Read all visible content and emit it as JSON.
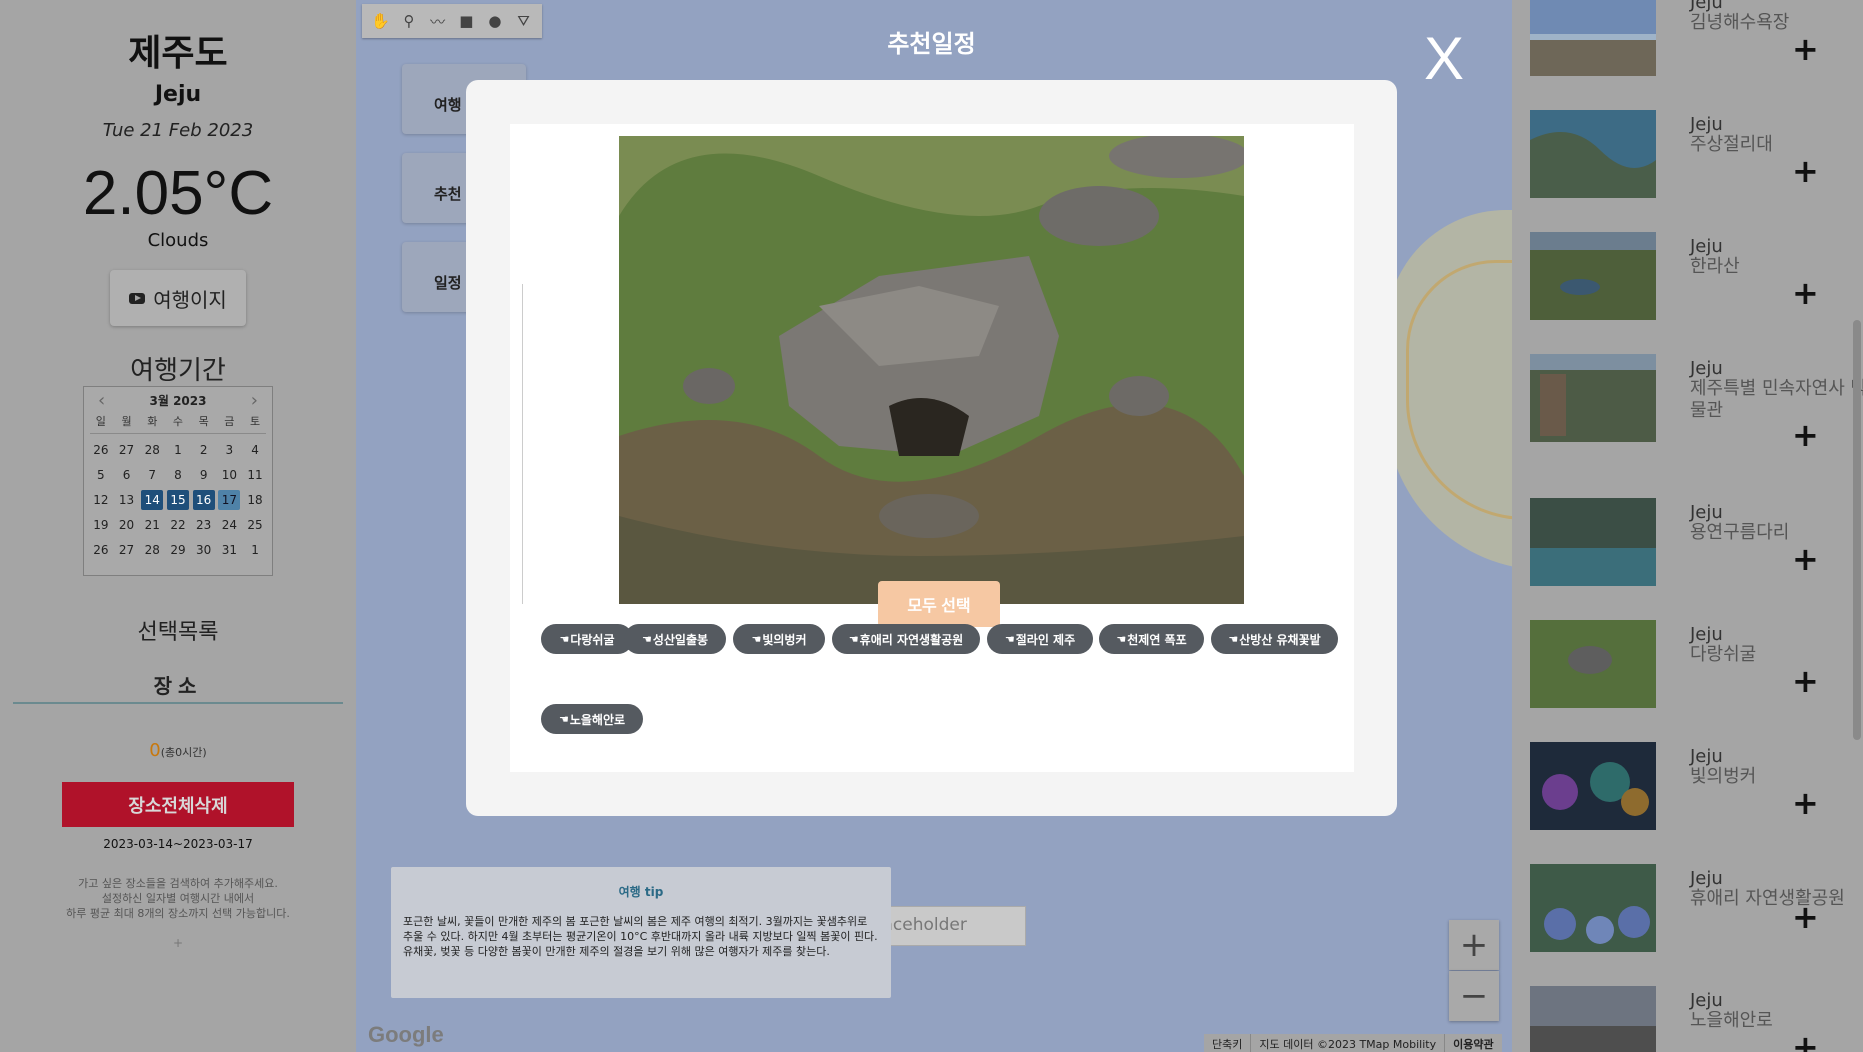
{
  "left": {
    "city_ko": "제주도",
    "city_en": "Jeju",
    "date": "Tue 21 Feb 2023",
    "temperature": "2.05°C",
    "weather": "Clouds",
    "brand_label": "여행이지",
    "period_title": "여행기간",
    "calendar": {
      "month_title": "3월 2023",
      "prev_arrow": "‹",
      "next_arrow": "›",
      "weekdays": [
        "일",
        "월",
        "화",
        "수",
        "목",
        "금",
        "토"
      ],
      "weeks": [
        [
          "26",
          "27",
          "28",
          "1",
          "2",
          "3",
          "4"
        ],
        [
          "5",
          "6",
          "7",
          "8",
          "9",
          "10",
          "11"
        ],
        [
          "12",
          "13",
          "14",
          "15",
          "16",
          "17",
          "18"
        ],
        [
          "19",
          "20",
          "21",
          "22",
          "23",
          "24",
          "25"
        ],
        [
          "26",
          "27",
          "28",
          "29",
          "30",
          "31",
          "1"
        ]
      ]
    },
    "list_title": "선택목록",
    "tab_place": "장소",
    "count_value": "0",
    "count_unit": "(총0시간)",
    "delete_all": "장소전체삭제",
    "range": "2023-03-14~2023-03-17",
    "help_lines": [
      "가고 싶은 장소들을 검색하여 추가해주세요.",
      "설정하신 일자별 여행시간 내에서",
      "하루 평균 최대 8개의 장소까지 선택 가능합니다."
    ],
    "help_plus": "+"
  },
  "map": {
    "tabs": [
      "여행",
      "추천",
      "일정"
    ],
    "search_placeholder": "placeholder",
    "zoom_in": "+",
    "zoom_out": "−",
    "google": "Google",
    "footer": [
      "단축키",
      "지도 데이터 ©2023 TMap Mobility",
      "이용약관"
    ],
    "tip_title": "여행 tip",
    "tip_body": "포근한 날씨, 꽃들이 만개한 제주의 봄 포근한 날씨의 봄은 제주 여행의 최적기. 3월까지는 꽃샘추위로 추울 수 있다. 하지만 4월 초부터는 평균기온이 10°C 후반대까지 올라 내륙 지방보다 일찍 봄꽃이 핀다. 유채꽃, 벚꽃 등 다양한 봄꽃이 만개한 제주의 절경을 보기 위해 많은 여행자가 제주를 찾는다."
  },
  "modal": {
    "title": "추천일정",
    "close": "X",
    "select_all": "모두 선택",
    "chips": [
      "다랑쉬굴",
      "성산일출봉",
      "빛의벙커",
      "휴애리 자연생활공원",
      "절라인 제주",
      "천제연 폭포",
      "산방산 유채꽃밭",
      "노을해안로"
    ]
  },
  "places": [
    {
      "region": "Jeju",
      "name": "김녕해수욕장",
      "add": "+"
    },
    {
      "region": "Jeju",
      "name": "주상절리대",
      "add": "+"
    },
    {
      "region": "Jeju",
      "name": "한라산",
      "add": "+"
    },
    {
      "region": "Jeju",
      "name": "제주특별 민속자연사 박물관",
      "add": "+"
    },
    {
      "region": "Jeju",
      "name": "용연구름다리",
      "add": "+"
    },
    {
      "region": "Jeju",
      "name": "다랑쉬굴",
      "add": "+"
    },
    {
      "region": "Jeju",
      "name": "빛의벙커",
      "add": "+"
    },
    {
      "region": "Jeju",
      "name": "휴애리 자연생활공원",
      "add": "+"
    },
    {
      "region": "Jeju",
      "name": "노을해안로",
      "add": "+"
    }
  ]
}
